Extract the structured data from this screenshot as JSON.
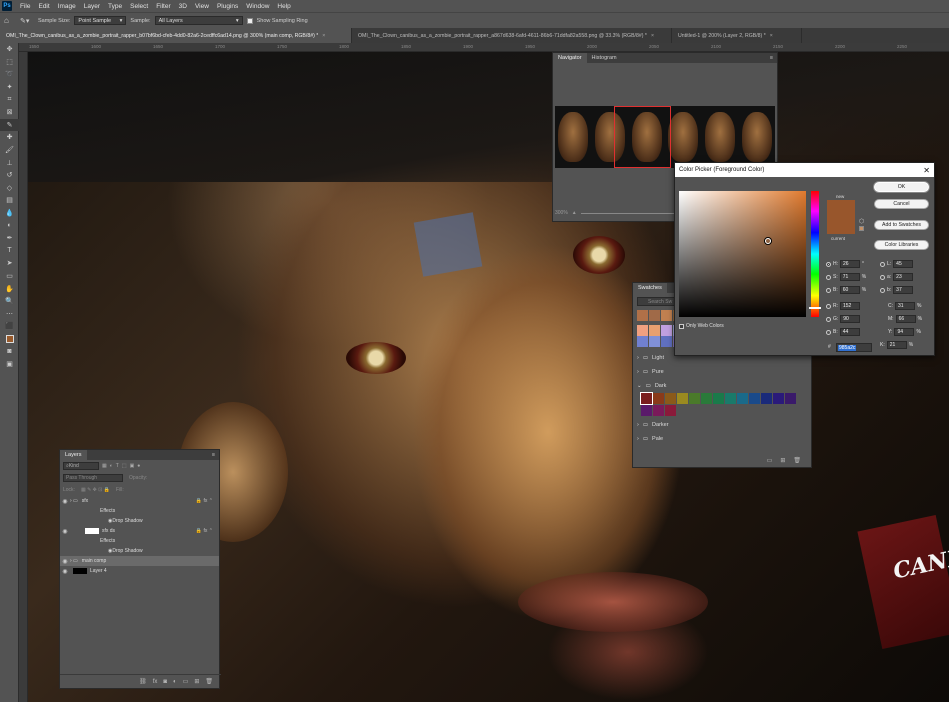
{
  "menubar": {
    "logo": "Ps",
    "items": [
      "File",
      "Edit",
      "Image",
      "Layer",
      "Type",
      "Select",
      "Filter",
      "3D",
      "View",
      "Plugins",
      "Window",
      "Help"
    ]
  },
  "options": {
    "sample_size_label": "Sample Size:",
    "sample_size_value": "Point Sample",
    "sample_label": "Sample:",
    "sample_value": "All Layers",
    "show_ring_label": "Show Sampling Ring"
  },
  "doc_tabs": [
    {
      "label": "OMI_The_Clown_canibus_as_a_zombie_portrait_rapper_b07bf6bd-cfeb-4dd0-82a6-2cedffc6ad14.png @ 300% (main comp, RGB/8#) *",
      "active": true
    },
    {
      "label": "OMI_The_Clown_canibus_as_a_zombie_portrait_rapper_a867d638-6afd-4611-86b6-71ddfa82a558.png @ 33.3% (RGB/8#) *",
      "active": false
    },
    {
      "label": "Untitled-1 @ 200% (Layer 2, RGB/8) *",
      "active": false
    }
  ],
  "ruler_ticks": [
    "1550",
    "1600",
    "1650",
    "1700",
    "1750",
    "1800",
    "1850",
    "1900",
    "1950",
    "2000",
    "2050",
    "2100",
    "2150",
    "2200",
    "2250"
  ],
  "canvas_overlay_text": "CANI",
  "navigator": {
    "tabs": [
      "Navigator",
      "Histogram"
    ],
    "zoom": "300%"
  },
  "swatches": {
    "title": "Swatches",
    "search_placeholder": "Search Sw",
    "recent": [
      "#b07048",
      "#a06a48",
      "#c08050",
      "#a07040",
      "#8a6a50"
    ],
    "row2": [
      "#f0a080",
      "#e8a070",
      "#c0a0e0",
      "#a8b0e8"
    ],
    "row3": [
      "#7080d0",
      "#8090d8",
      "#6070c0",
      "#9080d0"
    ],
    "groups": [
      "Light",
      "Pure",
      "Dark",
      "Darker",
      "Pale"
    ],
    "dark_colors": [
      "#7a1e1e",
      "#8a3a1a",
      "#8a5a1a",
      "#9a8a20",
      "#4a7a2a",
      "#2a7a3a",
      "#1a7a4a",
      "#1a7a6a",
      "#1a6a8a",
      "#1a4a8a",
      "#1a2a7a",
      "#2a1a7a",
      "#3a1a6a",
      "#5a1a6a",
      "#7a1a5a",
      "#8a1a3a"
    ]
  },
  "color_picker": {
    "title": "Color Picker (Foreground Color)",
    "new_label": "new",
    "current_label": "current",
    "ok": "OK",
    "cancel": "Cancel",
    "add_to_swatches": "Add to Swatches",
    "color_libraries": "Color Libraries",
    "only_web": "Only Web Colors",
    "H": "26",
    "S": "71",
    "B": "60",
    "R": "152",
    "G": "90",
    "Bl": "44",
    "L": "45",
    "a": "23",
    "b": "37",
    "C": "31",
    "M": "66",
    "Y": "94",
    "K": "21",
    "hex": "985a2c",
    "units": {
      "deg": "°",
      "pct": "%"
    },
    "color": "#985a2c"
  },
  "layers": {
    "title": "Layers",
    "kind": "Kind",
    "blend": "Pass Through",
    "opacity_label": "Opacity:",
    "lock_label": "Lock:",
    "fill_label": "Fill:",
    "rows": [
      {
        "name": "sfx",
        "kind": "group"
      },
      {
        "name": "Effects",
        "kind": "effects"
      },
      {
        "name": "Drop Shadow",
        "kind": "effect"
      },
      {
        "name": "sfx ds",
        "kind": "layer"
      },
      {
        "name": "Effects",
        "kind": "effects"
      },
      {
        "name": "Drop Shadow",
        "kind": "effect"
      },
      {
        "name": "main comp",
        "kind": "group"
      },
      {
        "name": "Layer 4",
        "kind": "layer"
      }
    ]
  }
}
